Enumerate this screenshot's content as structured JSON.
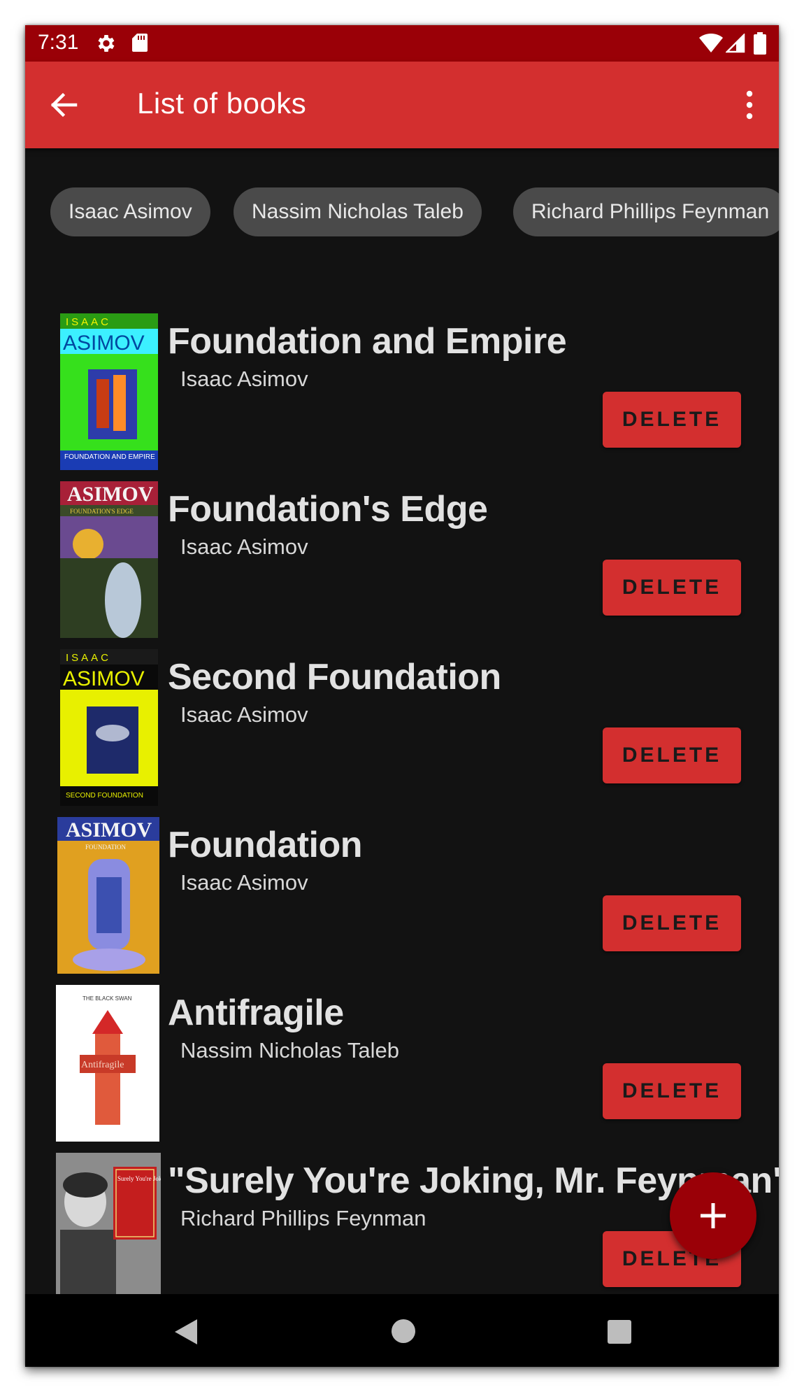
{
  "status_bar": {
    "time": "7:31",
    "icons": [
      "gear-icon",
      "sd-card-icon",
      "wifi-icon",
      "signal-icon",
      "battery-icon"
    ]
  },
  "app_bar": {
    "title": "List of books",
    "back_icon": "arrow-back-icon",
    "menu_icon": "more-vert-icon"
  },
  "filters": {
    "chips": [
      "Isaac Asimov",
      "Nassim Nicholas Taleb",
      "Richard Phillips Feynman"
    ]
  },
  "books": [
    {
      "title": "Foundation and Empire",
      "author": "Isaac Asimov",
      "delete_label": "DELETE"
    },
    {
      "title": "Foundation's Edge",
      "author": "Isaac Asimov",
      "delete_label": "DELETE"
    },
    {
      "title": "Second Foundation",
      "author": "Isaac Asimov",
      "delete_label": "DELETE"
    },
    {
      "title": "Foundation",
      "author": "Isaac Asimov",
      "delete_label": "DELETE"
    },
    {
      "title": "Antifragile",
      "author": "Nassim Nicholas Taleb",
      "delete_label": "DELETE"
    },
    {
      "title": "\"Surely You're Joking, Mr. Feynman\"",
      "author": "Richard Phillips Feynman",
      "delete_label": "DELETE"
    }
  ],
  "covers": [
    {
      "top_text": "ISAAC",
      "brand": "ASIMOV",
      "bottom_text": "FOUNDATION AND EMPIRE"
    },
    {
      "brand": "ASIMOV",
      "sub_text": "FOUNDATION'S EDGE"
    },
    {
      "top_text": "ISAAC",
      "brand": "ASIMOV",
      "bottom_text": "SECOND FOUNDATION"
    },
    {
      "brand": "ASIMOV",
      "sub_text": "FOUNDATION"
    },
    {
      "top_text": "THE BLACK SWAN",
      "title_text": "Antifragile"
    },
    {
      "title_text": "Surely You're Joking, Mr. Feynman!"
    }
  ],
  "fab": {
    "icon": "plus-icon"
  },
  "nav_bar": {
    "icons": [
      "nav-back-icon",
      "nav-home-icon",
      "nav-recents-icon"
    ]
  },
  "colors": {
    "primary": "#d32f2f",
    "primary_dark": "#9a0007",
    "background": "#121212",
    "chip": "#4a4a4a"
  }
}
